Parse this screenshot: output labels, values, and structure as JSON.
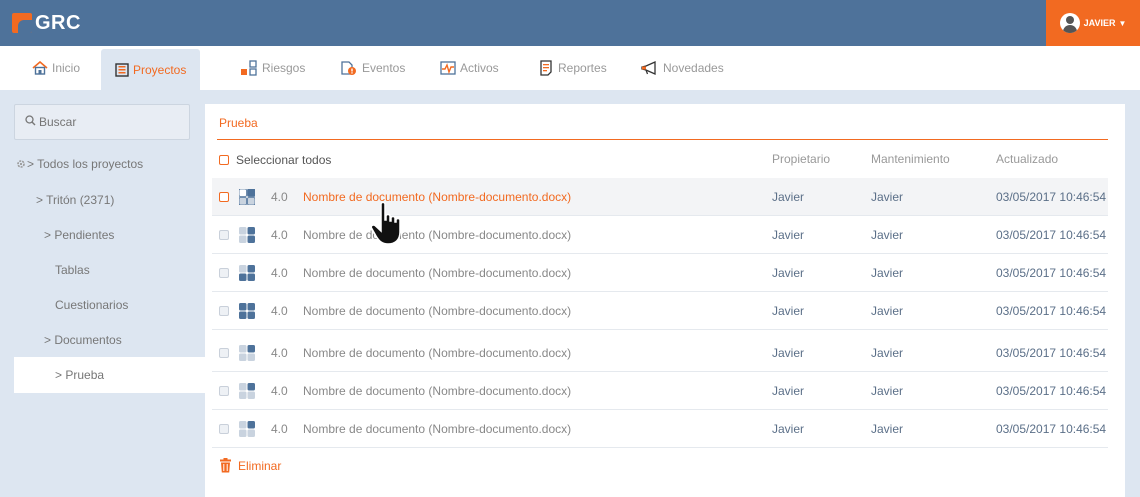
{
  "app": {
    "title": "GRC"
  },
  "user": {
    "name": "JAVIER"
  },
  "nav": [
    {
      "label": "Inicio",
      "icon": "home-icon"
    },
    {
      "label": "Proyectos",
      "icon": "projects-icon",
      "active": true
    },
    {
      "label": "Riesgos",
      "icon": "risks-icon"
    },
    {
      "label": "Eventos",
      "icon": "events-icon"
    },
    {
      "label": "Activos",
      "icon": "assets-icon"
    },
    {
      "label": "Reportes",
      "icon": "reports-icon"
    },
    {
      "label": "Novedades",
      "icon": "megaphone-icon"
    }
  ],
  "sidebar": {
    "search_placeholder": "Buscar",
    "items": [
      {
        "label": "> Todos los proyectos"
      },
      {
        "label": "> Tritón (2371)"
      },
      {
        "label": "> Pendientes"
      },
      {
        "label": "Tablas"
      },
      {
        "label": "Cuestionarios"
      },
      {
        "label": "> Documentos"
      },
      {
        "label": "> Prueba",
        "active": true
      }
    ]
  },
  "main": {
    "title": "Prueba",
    "select_all": "Seleccionar todos",
    "columns": {
      "owner": "Propietario",
      "maintenance": "Mantenimiento",
      "updated": "Actualizado"
    },
    "rows": [
      {
        "version": "4.0",
        "name": "Nombre de documento (Nombre-documento.docx)",
        "owner": "Javier",
        "maintenance": "Javier",
        "updated": "03/05/2017 10:46:54",
        "progress": 0.25
      },
      {
        "version": "4.0",
        "name": "Nombre de documento (Nombre-documento.docx)",
        "owner": "Javier",
        "maintenance": "Javier",
        "updated": "03/05/2017 10:46:54",
        "progress": 0.5
      },
      {
        "version": "4.0",
        "name": "Nombre de documento (Nombre-documento.docx)",
        "owner": "Javier",
        "maintenance": "Javier",
        "updated": "03/05/2017 10:46:54",
        "progress": 0.75
      },
      {
        "version": "4.0",
        "name": "Nombre de documento (Nombre-documento.docx)",
        "owner": "Javier",
        "maintenance": "Javier",
        "updated": "03/05/2017 10:46:54",
        "progress": 1.0
      },
      {
        "version": "4.0",
        "name": "Nombre de documento (Nombre-documento.docx)",
        "owner": "Javier",
        "maintenance": "Javier",
        "updated": "03/05/2017 10:46:54",
        "progress": 0.25
      },
      {
        "version": "4.0",
        "name": "Nombre de documento (Nombre-documento.docx)",
        "owner": "Javier",
        "maintenance": "Javier",
        "updated": "03/05/2017 10:46:54",
        "progress": 0.25
      },
      {
        "version": "4.0",
        "name": "Nombre de documento (Nombre-documento.docx)",
        "owner": "Javier",
        "maintenance": "Javier",
        "updated": "03/05/2017 10:46:54",
        "progress": 0.25
      }
    ],
    "delete_label": "Eliminar"
  },
  "colors": {
    "accent": "#f26a21",
    "header": "#4e729a",
    "background": "#dde6f1"
  }
}
